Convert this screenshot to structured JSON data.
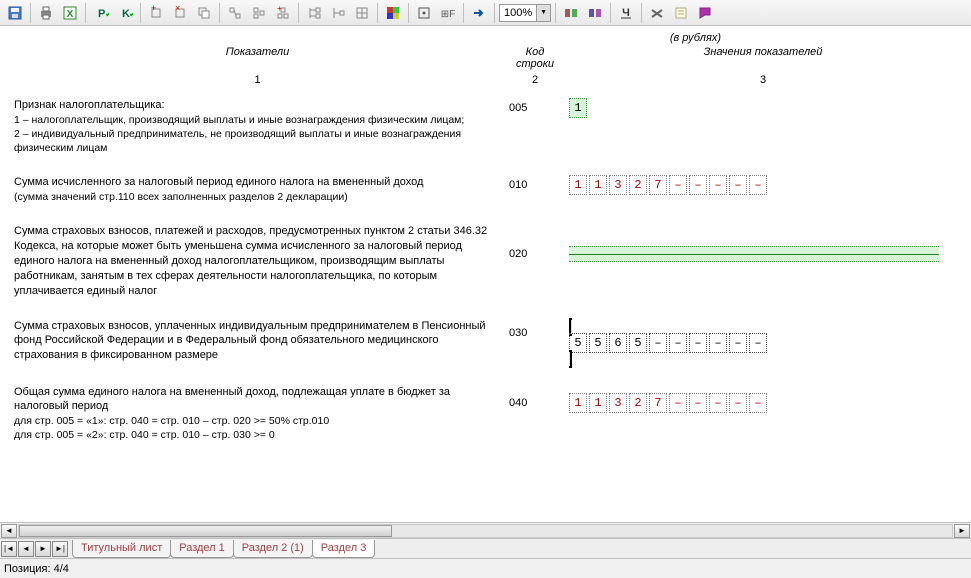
{
  "toolbar": {
    "zoom": "100%"
  },
  "units_label": "(в рублях)",
  "headers": {
    "indicators": "Показатели",
    "code": "Код строки",
    "values": "Значения показателей",
    "sub1": "1",
    "sub2": "2",
    "sub3": "3"
  },
  "rows": [
    {
      "title": "Признак налогоплательщика:",
      "sub1": "1 – налогоплательщик, производящий выплаты и иные вознаграждения физическим лицам;",
      "sub2": "2 – индивидуальный предприниматель, не производящий выплаты и иные вознаграждения физическим лицам",
      "code": "005",
      "cells": [
        "1"
      ],
      "style": "green"
    },
    {
      "title": "Сумма исчисленного за налоговый период единого налога на вмененный доход",
      "sub1": "(сумма значений стр.110 всех заполненных разделов 2 декларации)",
      "code": "010",
      "cells": [
        "1",
        "1",
        "3",
        "2",
        "7",
        "–",
        "–",
        "–",
        "–",
        "–"
      ],
      "style": "red"
    },
    {
      "title": "Сумма страховых взносов, платежей и расходов, предусмотренных пунктом 2 статьи 346.32 Кодекса, на которые может быть уменьшена сумма исчисленного за налоговый период единого налога на вмененный доход налогоплательщиком, производящим выплаты работникам, занятым в тех сферах деятельности налогоплательщика, по которым уплачивается единый налог",
      "code": "020",
      "style": "greenstrip"
    },
    {
      "title": "Сумма страховых взносов, уплаченных индивидуальным предпринимателем в Пенсионный фонд Российской Федерации и в Федеральный фонд обязательного медицинского страхования в фиксированном размере",
      "code": "030",
      "cells": [
        "5",
        "5",
        "6",
        "5",
        "–",
        "–",
        "–",
        "–",
        "–",
        "–"
      ],
      "style": "focus"
    },
    {
      "title": "Общая сумма единого налога на вмененный доход, подлежащая уплате в бюджет за налоговый период",
      "sub1": "для стр. 005 = «1»: стр. 040 = стр. 010 – стр. 020 >= 50% стр.010",
      "sub2": "для стр. 005 = «2»: стр. 040 = стр. 010 – стр. 030 >= 0",
      "code": "040",
      "cells": [
        "1",
        "1",
        "3",
        "2",
        "7",
        "–",
        "–",
        "–",
        "–",
        "–"
      ],
      "style": "red"
    }
  ],
  "tabs": [
    "Титульный лист",
    "Раздел 1",
    "Раздел 2 (1)",
    "Раздел 3"
  ],
  "status": {
    "label": "Позиция:",
    "value": "4/4"
  }
}
